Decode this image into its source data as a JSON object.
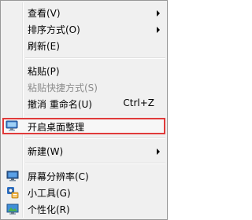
{
  "menu": {
    "view": "查看(V)",
    "sort": "排序方式(O)",
    "refresh": "刷新(E)",
    "paste": "粘贴(P)",
    "paste_shortcut": "粘贴快捷方式(S)",
    "undo_rename": "撤消 重命名(U)",
    "undo_shortcut": "Ctrl+Z",
    "open_desktop_organizer": "开启桌面整理",
    "new": "新建(W)",
    "screen_resolution": "屏幕分辨率(C)",
    "gadgets": "小工具(G)",
    "personalize": "个性化(R)"
  },
  "icons": {
    "desktop_organizer": "monitor-icon",
    "screen_resolution": "display-icon",
    "gadgets": "gadgets-icon",
    "personalize": "personalize-icon"
  },
  "colors": {
    "menu_bg": "#f0f0f0",
    "highlight_border": "#e03a3a",
    "disabled_text": "#8d8d8d"
  }
}
